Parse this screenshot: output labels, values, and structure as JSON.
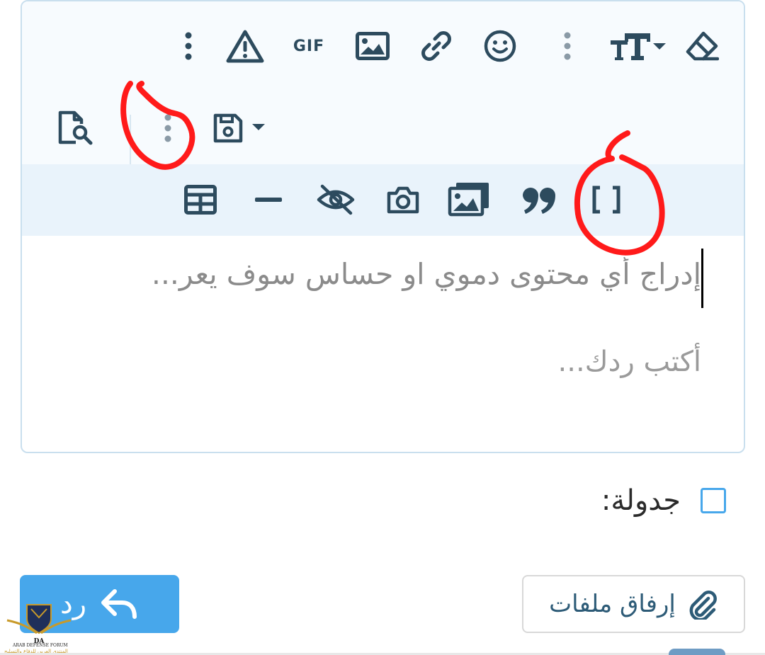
{
  "toolbar": {
    "row1": [
      {
        "name": "more-options-icon",
        "label": "more"
      },
      {
        "name": "warning-icon",
        "label": "spoiler"
      },
      {
        "name": "gif-icon",
        "label": "GIF"
      },
      {
        "name": "image-icon",
        "label": "image"
      },
      {
        "name": "link-icon",
        "label": "link"
      },
      {
        "name": "smiley-icon",
        "label": "smilies"
      },
      {
        "name": "separator-dots-icon",
        "label": "separator"
      },
      {
        "name": "text-size-icon",
        "label": "text size"
      },
      {
        "name": "eraser-icon",
        "label": "remove formatting"
      }
    ],
    "row2": [
      {
        "name": "preview-icon",
        "label": "preview"
      },
      {
        "name": "separator-dots-icon",
        "label": "separator"
      },
      {
        "name": "save-draft-icon",
        "label": "drafts"
      }
    ],
    "row3": [
      {
        "name": "table-icon",
        "label": "table"
      },
      {
        "name": "horizontal-line-icon",
        "label": "horizontal line"
      },
      {
        "name": "hide-icon",
        "label": "hide content"
      },
      {
        "name": "camera-icon",
        "label": "camera"
      },
      {
        "name": "gallery-icon",
        "label": "gallery"
      },
      {
        "name": "quote-icon",
        "label": "quote"
      },
      {
        "name": "brackets-icon",
        "label": "code"
      }
    ],
    "gif_text": "GIF"
  },
  "editor": {
    "spoiler_text": "إدراج أي محتوى دموي او حساس سوف يعر...",
    "placeholder": "أكتب ردك..."
  },
  "form": {
    "checkbox_label": "جدولة:",
    "checkbox_checked": false,
    "reply_label": "رد",
    "attach_label": "إرفاق ملفات"
  },
  "logo": {
    "initials": "DA",
    "name_en": "ARAB DEFENSE FORUM",
    "name_ar": "المنتدى العربي للدفاع والتسليح"
  },
  "colors": {
    "accent": "#47a7eb",
    "icon": "#2d4b5e",
    "annotation": "#ff1a1a",
    "toolbar_row3_bg": "#e9f3fb"
  }
}
